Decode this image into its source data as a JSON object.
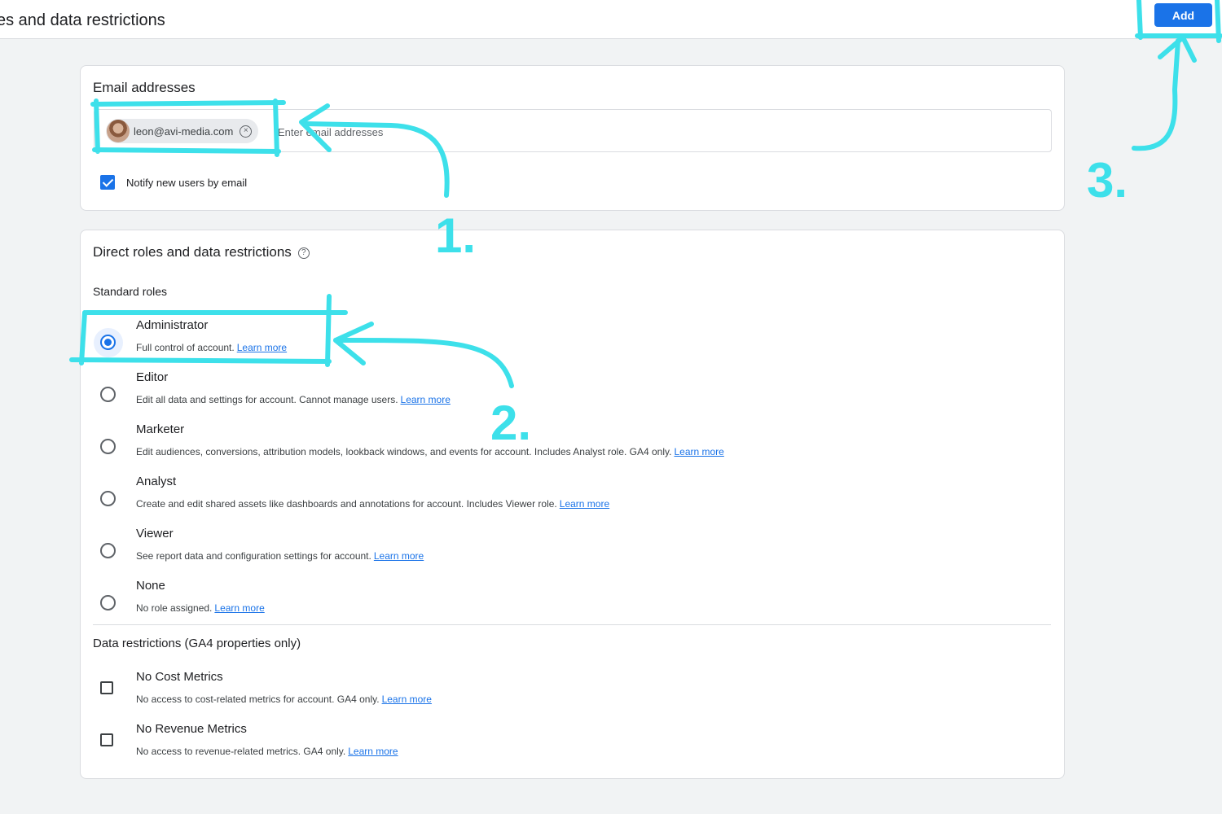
{
  "header": {
    "title": "es and data restrictions",
    "add_label": "Add"
  },
  "email_section": {
    "heading": "Email addresses",
    "chip_email": "leon@avi-media.com",
    "chip_close_glyph": "×",
    "input_placeholder": "Enter email addresses",
    "notify_label": "Notify new users by email",
    "notify_checked": true
  },
  "roles_section": {
    "heading": "Direct roles and data restrictions",
    "help_glyph": "?",
    "standard_roles_label": "Standard roles",
    "selected_role": "Administrator",
    "roles": [
      {
        "name": "Administrator",
        "description": "Full control of account.",
        "link": "Learn more"
      },
      {
        "name": "Editor",
        "description": "Edit all data and settings for account. Cannot manage users.",
        "link": "Learn more"
      },
      {
        "name": "Marketer",
        "description": "Edit audiences, conversions, attribution models, lookback windows, and events for account. Includes Analyst role. GA4 only.",
        "link": "Learn more"
      },
      {
        "name": "Analyst",
        "description": "Create and edit shared assets like dashboards and annotations for account. Includes Viewer role.",
        "link": "Learn more"
      },
      {
        "name": "Viewer",
        "description": "See report data and configuration settings for account.",
        "link": "Learn more"
      },
      {
        "name": "None",
        "description": "No role assigned.",
        "link": "Learn more"
      }
    ],
    "data_restrictions_label": "Data restrictions (GA4 properties only)",
    "restrictions": [
      {
        "name": "No Cost Metrics",
        "description": "No access to cost-related metrics for account. GA4 only.",
        "link": "Learn more",
        "checked": false
      },
      {
        "name": "No Revenue Metrics",
        "description": "No access to revenue-related metrics. GA4 only.",
        "link": "Learn more",
        "checked": false
      }
    ]
  },
  "annotations": {
    "color": "#3de0ea",
    "steps": [
      "1.",
      "2.",
      "3."
    ]
  }
}
